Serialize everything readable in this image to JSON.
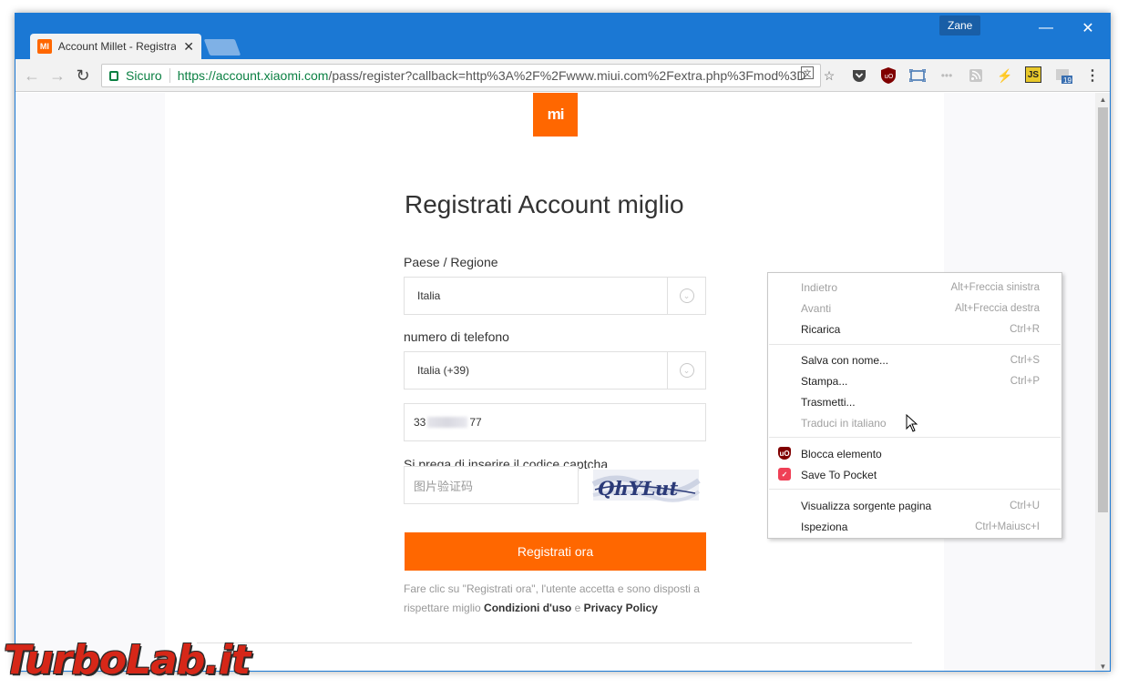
{
  "browser": {
    "tab_title": "Account Millet - Registra",
    "tab_favicon": "MI",
    "profile_name": "Zane",
    "security_label": "Sicuro",
    "url_scheme_host": "https://account.xiaomi.com",
    "url_path": "/pass/register?callback=http%3A%2F%2Fwww.miui.com%2Fextra.php%3Fmod%3D",
    "calendar_badge": "19",
    "extension_js_label": "JS"
  },
  "page": {
    "logo_text": "mi",
    "heading": "Registrati Account miglio",
    "country_label": "Paese / Regione",
    "country_value": "Italia",
    "phone_label": "numero di telefono",
    "phone_prefix_value": "Italia (+39)",
    "phone_number_start": "33",
    "phone_number_end": "77",
    "captcha_label": "Si prega di inserire il codice captcha",
    "captcha_placeholder": "图片验证码",
    "captcha_text": "QhYLut",
    "register_button": "Registrati ora",
    "terms_text": "Fare clic su \"Registrati ora\", l'utente accetta e sono disposti a rispettare miglio",
    "terms_link": "Condizioni d'uso",
    "terms_and": "e",
    "privacy_link": "Privacy Policy"
  },
  "context_menu": {
    "items": [
      {
        "label": "Indietro",
        "shortcut": "Alt+Freccia sinistra",
        "disabled": true
      },
      {
        "label": "Avanti",
        "shortcut": "Alt+Freccia destra",
        "disabled": true
      },
      {
        "label": "Ricarica",
        "shortcut": "Ctrl+R",
        "disabled": false
      },
      {
        "label": "Salva con nome...",
        "shortcut": "Ctrl+S",
        "disabled": false
      },
      {
        "label": "Stampa...",
        "shortcut": "Ctrl+P",
        "disabled": false
      },
      {
        "label": "Trasmetti...",
        "shortcut": "",
        "disabled": false
      },
      {
        "label": "Traduci in italiano",
        "shortcut": "",
        "disabled": true
      },
      {
        "label": "Blocca elemento",
        "shortcut": "",
        "disabled": false,
        "icon": "ublock-icon"
      },
      {
        "label": "Save To Pocket",
        "shortcut": "",
        "disabled": false,
        "icon": "pocket-icon"
      },
      {
        "label": "Visualizza sorgente pagina",
        "shortcut": "Ctrl+U",
        "disabled": false
      },
      {
        "label": "Ispeziona",
        "shortcut": "Ctrl+Maiusc+I",
        "disabled": false
      }
    ]
  },
  "watermark": {
    "text": "TurboLab.it"
  },
  "colors": {
    "titlebar": "#1b78d4",
    "xiaomi_orange": "#ff6700",
    "secure_green": "#0b8043"
  }
}
